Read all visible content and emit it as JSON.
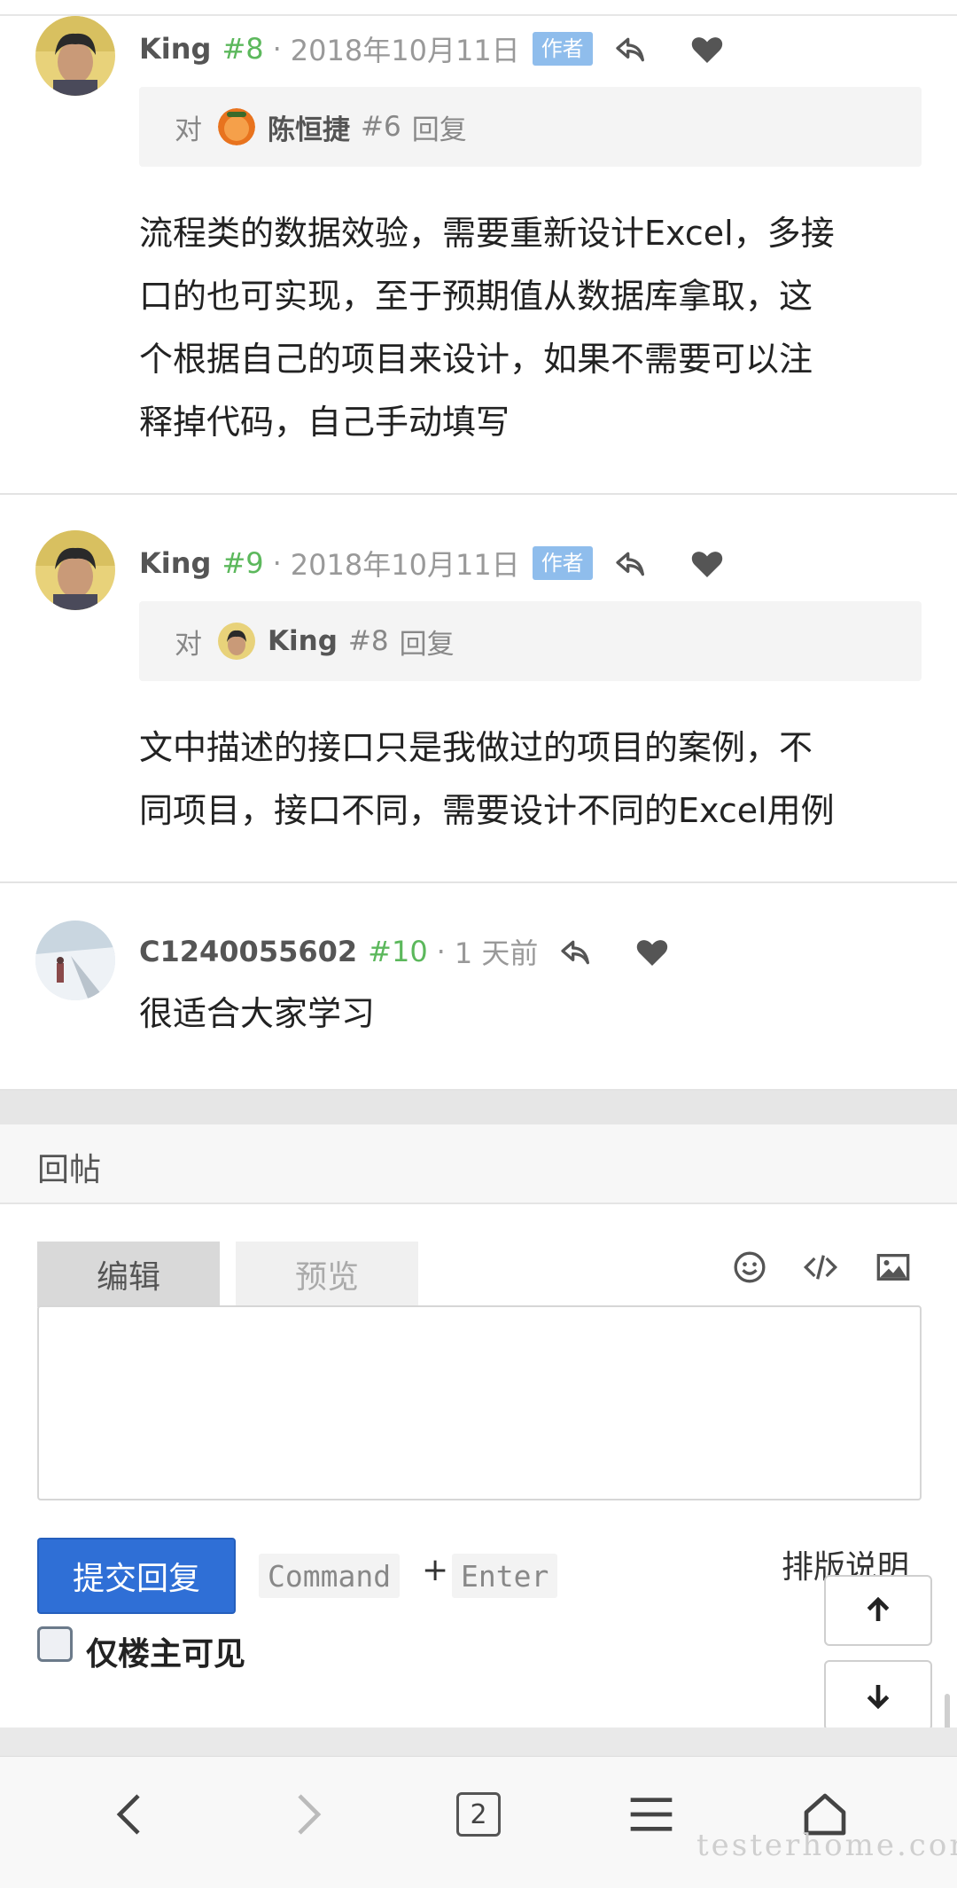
{
  "replies": [
    {
      "author": "King",
      "floor": "#8",
      "separator": "·",
      "date": "2018年10月11日",
      "badge": "作者",
      "quote": {
        "prefix": "对",
        "name": "陈恒捷",
        "floor": "#6",
        "suffix": "回复"
      },
      "lines": [
        "流程类的数据效验，需要重新设计Excel，多接",
        "口的也可实现，至于预期值从数据库拿取，这",
        "个根据自己的项目来设计，如果不需要可以注",
        "释掉代码，自己手动填写"
      ]
    },
    {
      "author": "King",
      "floor": "#9",
      "separator": "·",
      "date": "2018年10月11日",
      "badge": "作者",
      "quote": {
        "prefix": "对",
        "name": "King",
        "floor": "#8",
        "suffix": "回复"
      },
      "lines": [
        "文中描述的接口只是我做过的项目的案例，不",
        "同项目，接口不同，需要设计不同的Excel用例"
      ]
    },
    {
      "author": "C1240055602",
      "floor": "#10",
      "separator": "·",
      "date": "1 天前",
      "lines": [
        "很适合大家学习"
      ]
    }
  ],
  "reply_panel": {
    "title": "回帖",
    "tabs": [
      "编辑",
      "预览"
    ],
    "tools": [
      "emoji-icon",
      "code-icon",
      "image-icon"
    ],
    "submit_label": "提交回复",
    "shortcut": [
      "Command",
      "+",
      "Enter"
    ],
    "help_link": "排版说明",
    "checkbox_label": "仅楼主可见"
  },
  "floating": [
    "arrow-up-icon",
    "arrow-down-icon"
  ],
  "bottom_nav": {
    "items": [
      "back-icon",
      "forward-icon",
      "tabs-icon",
      "menu-icon",
      "home-icon"
    ],
    "tab_count": "2"
  },
  "watermark": "testerhome.com",
  "colors": {
    "accent": "#2f6fd6",
    "floor": "#5cb85c",
    "badge": "#8fbdec"
  }
}
